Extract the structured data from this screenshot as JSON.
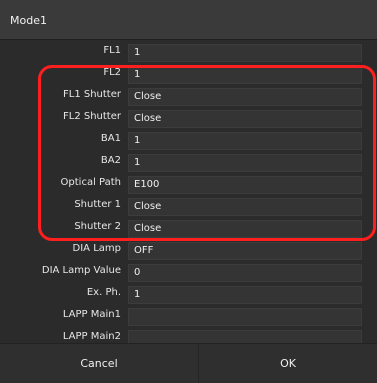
{
  "window": {
    "title": "Mode1"
  },
  "rows": [
    {
      "label": "FL1",
      "value": "1"
    },
    {
      "label": "FL2",
      "value": "1"
    },
    {
      "label": "FL1 Shutter",
      "value": "Close"
    },
    {
      "label": "FL2 Shutter",
      "value": "Close"
    },
    {
      "label": "BA1",
      "value": "1"
    },
    {
      "label": "BA2",
      "value": "1"
    },
    {
      "label": "Optical Path",
      "value": "E100"
    },
    {
      "label": "Shutter 1",
      "value": "Close"
    },
    {
      "label": "Shutter 2",
      "value": "Close"
    },
    {
      "label": "DIA Lamp",
      "value": "OFF"
    },
    {
      "label": "DIA Lamp Value",
      "value": "0"
    },
    {
      "label": "Ex. Ph.",
      "value": "1"
    },
    {
      "label": "LAPP Main1",
      "value": ""
    },
    {
      "label": "LAPP Main2",
      "value": ""
    }
  ],
  "buttons": {
    "cancel": "Cancel",
    "ok": "OK"
  },
  "colors": {
    "highlight": "#ff1f1f",
    "background": "#2b2b2b"
  }
}
